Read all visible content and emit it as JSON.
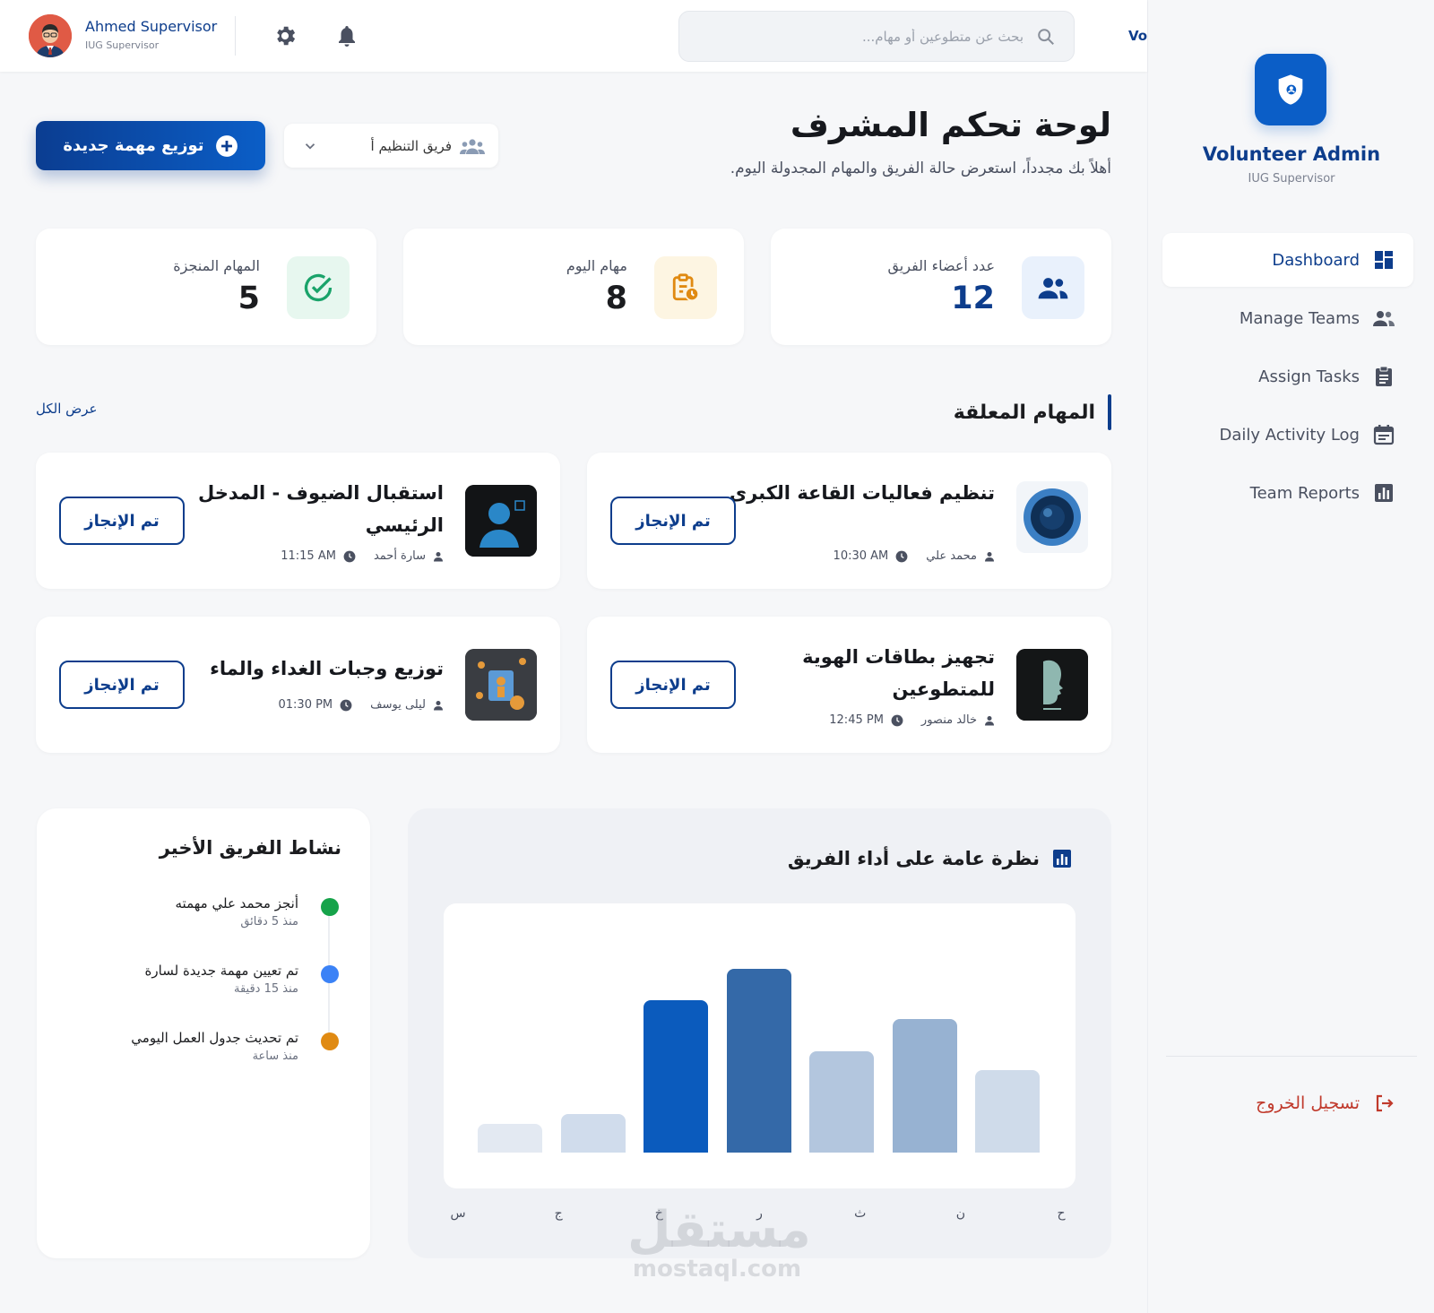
{
  "sidebar": {
    "brand_title": "Volunteer Admin",
    "brand_sub": "IUG Supervisor",
    "items": [
      {
        "label": "Dashboard",
        "icon": "dashboard-icon",
        "active": true
      },
      {
        "label": "Manage Teams",
        "icon": "team-icon"
      },
      {
        "label": "Assign Tasks",
        "icon": "clipboard-icon"
      },
      {
        "label": "Daily Activity Log",
        "icon": "calendar-icon"
      },
      {
        "label": "Team Reports",
        "icon": "bar-chart-icon"
      }
    ],
    "logout_label": "تسجيل الخروج"
  },
  "topbar": {
    "user_name": "Ahmed Supervisor",
    "user_role": "IUG Supervisor",
    "search_placeholder": "بحث عن متطوعين أو مهام...",
    "brand_partial": "Vol"
  },
  "header": {
    "title": "لوحة تحكم المشرف",
    "subtitle": "أهلاً بك مجدداً، استعرض حالة الفريق والمهام المجدولة اليوم.",
    "team_select": "فريق التنظيم أ",
    "new_task_label": "توزيع مهمة جديدة"
  },
  "stats": [
    {
      "label": "عدد أعضاء الفريق",
      "value": "12",
      "color": "#0d3d8c",
      "icon": "users-icon"
    },
    {
      "label": "مهام اليوم",
      "value": "8",
      "color": "#16181d",
      "icon": "task-clock-icon"
    },
    {
      "label": "المهام المنجزة",
      "value": "5",
      "color": "#16181d",
      "icon": "check-circle-icon"
    }
  ],
  "pending": {
    "title": "المهام المعلقة",
    "view_all": "عرض الكل",
    "done_label": "تم الإنجاز",
    "tasks": [
      {
        "title": "تنظيم فعاليات القاعة الكبرى",
        "person": "محمد علي",
        "time": "10:30 AM"
      },
      {
        "title": "استقبال الضيوف - المدخل الرئيسي",
        "person": "سارة أحمد",
        "time": "11:15 AM"
      },
      {
        "title": "تجهيز بطاقات الهوية للمتطوعين",
        "person": "خالد منصور",
        "time": "12:45 PM"
      },
      {
        "title": "توزيع وجبات الغداء والماء",
        "person": "ليلى يوسف",
        "time": "01:30 PM"
      }
    ]
  },
  "activity": {
    "title": "نشاط الفريق الأخير",
    "items": [
      {
        "text": "أنجز محمد علي مهمته",
        "time": "منذ 5 دقائق",
        "color": "#16a34a"
      },
      {
        "text": "تم تعيين مهمة جديدة لسارة",
        "time": "منذ 15 دقيقة",
        "color": "#3b82f6"
      },
      {
        "text": "تم تحديث جدول العمل اليومي",
        "time": "منذ ساعة",
        "color": "#e08a12"
      }
    ]
  },
  "chart_data": {
    "type": "bar",
    "title": "نظرة عامة على أداء الفريق",
    "categories": [
      "س",
      "ج",
      "خ",
      "ر",
      "ث",
      "ن",
      "ح"
    ],
    "values": [
      12,
      16,
      63,
      76,
      42,
      55,
      34
    ],
    "colors": [
      "#e3e9f2",
      "#d0dcec",
      "#0b5bbd",
      "#3469a8",
      "#b3c6de",
      "#97b2d2",
      "#cfdbea"
    ],
    "ylim": [
      0,
      100
    ],
    "grid": false
  }
}
